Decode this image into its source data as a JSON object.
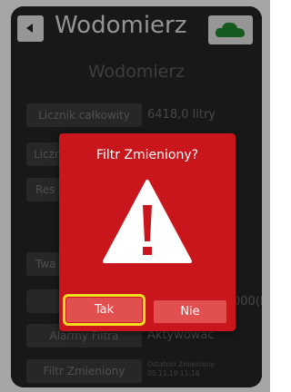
{
  "header": {
    "back_icon": "chevron-left-icon",
    "title": "Wodomierz",
    "cloud_icon": "cloud-icon",
    "cloud_color": "#1f8a2e"
  },
  "main": {
    "section_title": "Wodomierz",
    "rows": [
      {
        "label": "Licznik całkowity",
        "value": "6418,0 litry"
      },
      {
        "label": "Liczn"
      },
      {
        "label": "Res"
      },
      {
        "label": "Twa"
      },
      {
        "value": "000(L)"
      },
      {
        "label": "Alarmy Filtra",
        "value": "Aktywować"
      },
      {
        "label": "Filtr Zmieniony",
        "info_line1": "Ostatnio Zmieniony",
        "info_line2": "05.11.19 11:18"
      }
    ]
  },
  "dialog": {
    "title": "Filtr Zmieniony?",
    "warning_icon": "warning-triangle-icon",
    "yes_label": "Tak",
    "no_label": "Nie",
    "background": "#c9161c",
    "button_color": "#e14f4f",
    "highlight_color": "#f0df22"
  }
}
